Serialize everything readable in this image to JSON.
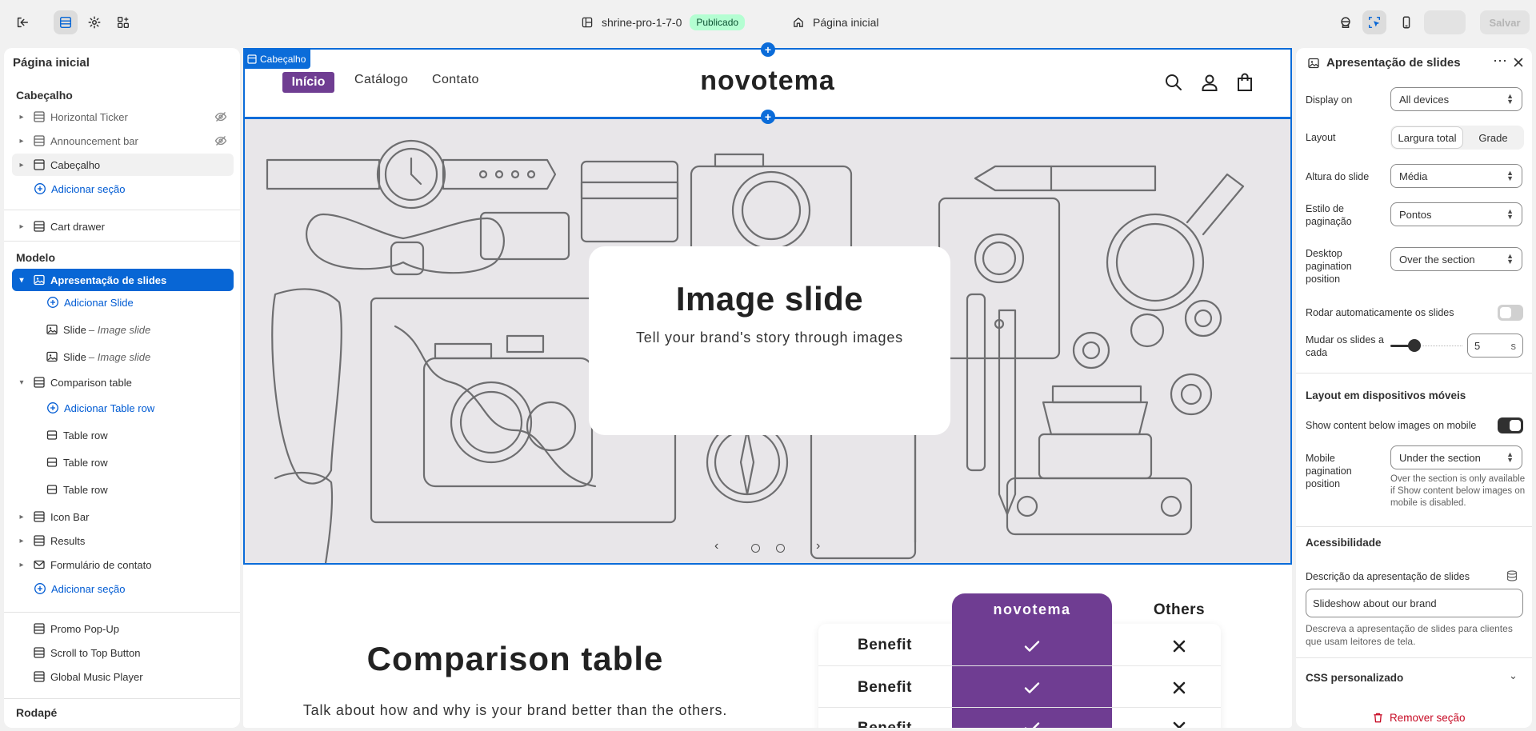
{
  "topbar": {
    "theme_name": "shrine-pro-1-7-0",
    "status_badge": "Publicado",
    "page_name": "Página inicial",
    "save_label": "Salvar"
  },
  "sidebar": {
    "title": "Página inicial",
    "header_group": "Cabeçalho",
    "header_items": [
      "Horizontal Ticker",
      "Announcement bar",
      "Cabeçalho"
    ],
    "add_section_label": "Adicionar seção",
    "cart_drawer": "Cart drawer",
    "template_group": "Modelo",
    "slideshow_item": "Apresentação de slides",
    "add_slide_label": "Adicionar Slide",
    "slide_label": "Slide",
    "slide_sub": "– Image slide",
    "comparison_item": "Comparison table",
    "add_table_row_label": "Adicionar Table row",
    "table_row_label": "Table row",
    "icon_bar": "Icon Bar",
    "results": "Results",
    "contact_form": "Formulário de contato",
    "popup_items": [
      "Promo Pop-Up",
      "Scroll to Top Button",
      "Global Music Player"
    ],
    "footer_group": "Rodapé"
  },
  "canvas": {
    "selected_tag": "Cabeçalho",
    "nav": [
      "Início",
      "Catálogo",
      "Contato"
    ],
    "brand": "novotema",
    "slide_title": "Image slide",
    "slide_subtitle": "Tell your brand's story through images",
    "comparison_title": "Comparison table",
    "comparison_sub": "Talk about how and why is your brand better than the others.",
    "comparison_brand_col": "novotema",
    "comparison_others_col": "Others",
    "benefit_label": "Benefit",
    "colors": {
      "brand_purple": "#6f3d92",
      "selection_blue": "#0b6cd9"
    }
  },
  "panel": {
    "title": "Apresentação de slides",
    "display_on_label": "Display on",
    "display_on_value": "All devices",
    "layout_label": "Layout",
    "layout_options": [
      "Largura total",
      "Grade"
    ],
    "slide_height_label": "Altura do slide",
    "slide_height_value": "Média",
    "pagination_style_label": "Estilo de paginação",
    "pagination_style_value": "Pontos",
    "desktop_pagination_label": "Desktop pagination position",
    "desktop_pagination_value": "Over the section",
    "autorotate_label": "Rodar automaticamente os slides",
    "change_every_label": "Mudar os slides a cada",
    "change_every_value": "5",
    "change_every_unit": "s",
    "mobile_layout_head": "Layout em dispositivos móveis",
    "show_below_label": "Show content below images on mobile",
    "mobile_pagination_label": "Mobile pagination position",
    "mobile_pagination_value": "Under the section",
    "mobile_pagination_help": "Over the section is only available if Show content below images on mobile is disabled.",
    "accessibility_head": "Acessibilidade",
    "slideshow_desc_label": "Descrição da apresentação de slides",
    "slideshow_desc_value": "Slideshow about our brand",
    "slideshow_desc_help": "Descreva a apresentação de slides para clientes que usam leitores de tela.",
    "custom_css_head": "CSS personalizado",
    "remove_label": "Remover seção"
  }
}
